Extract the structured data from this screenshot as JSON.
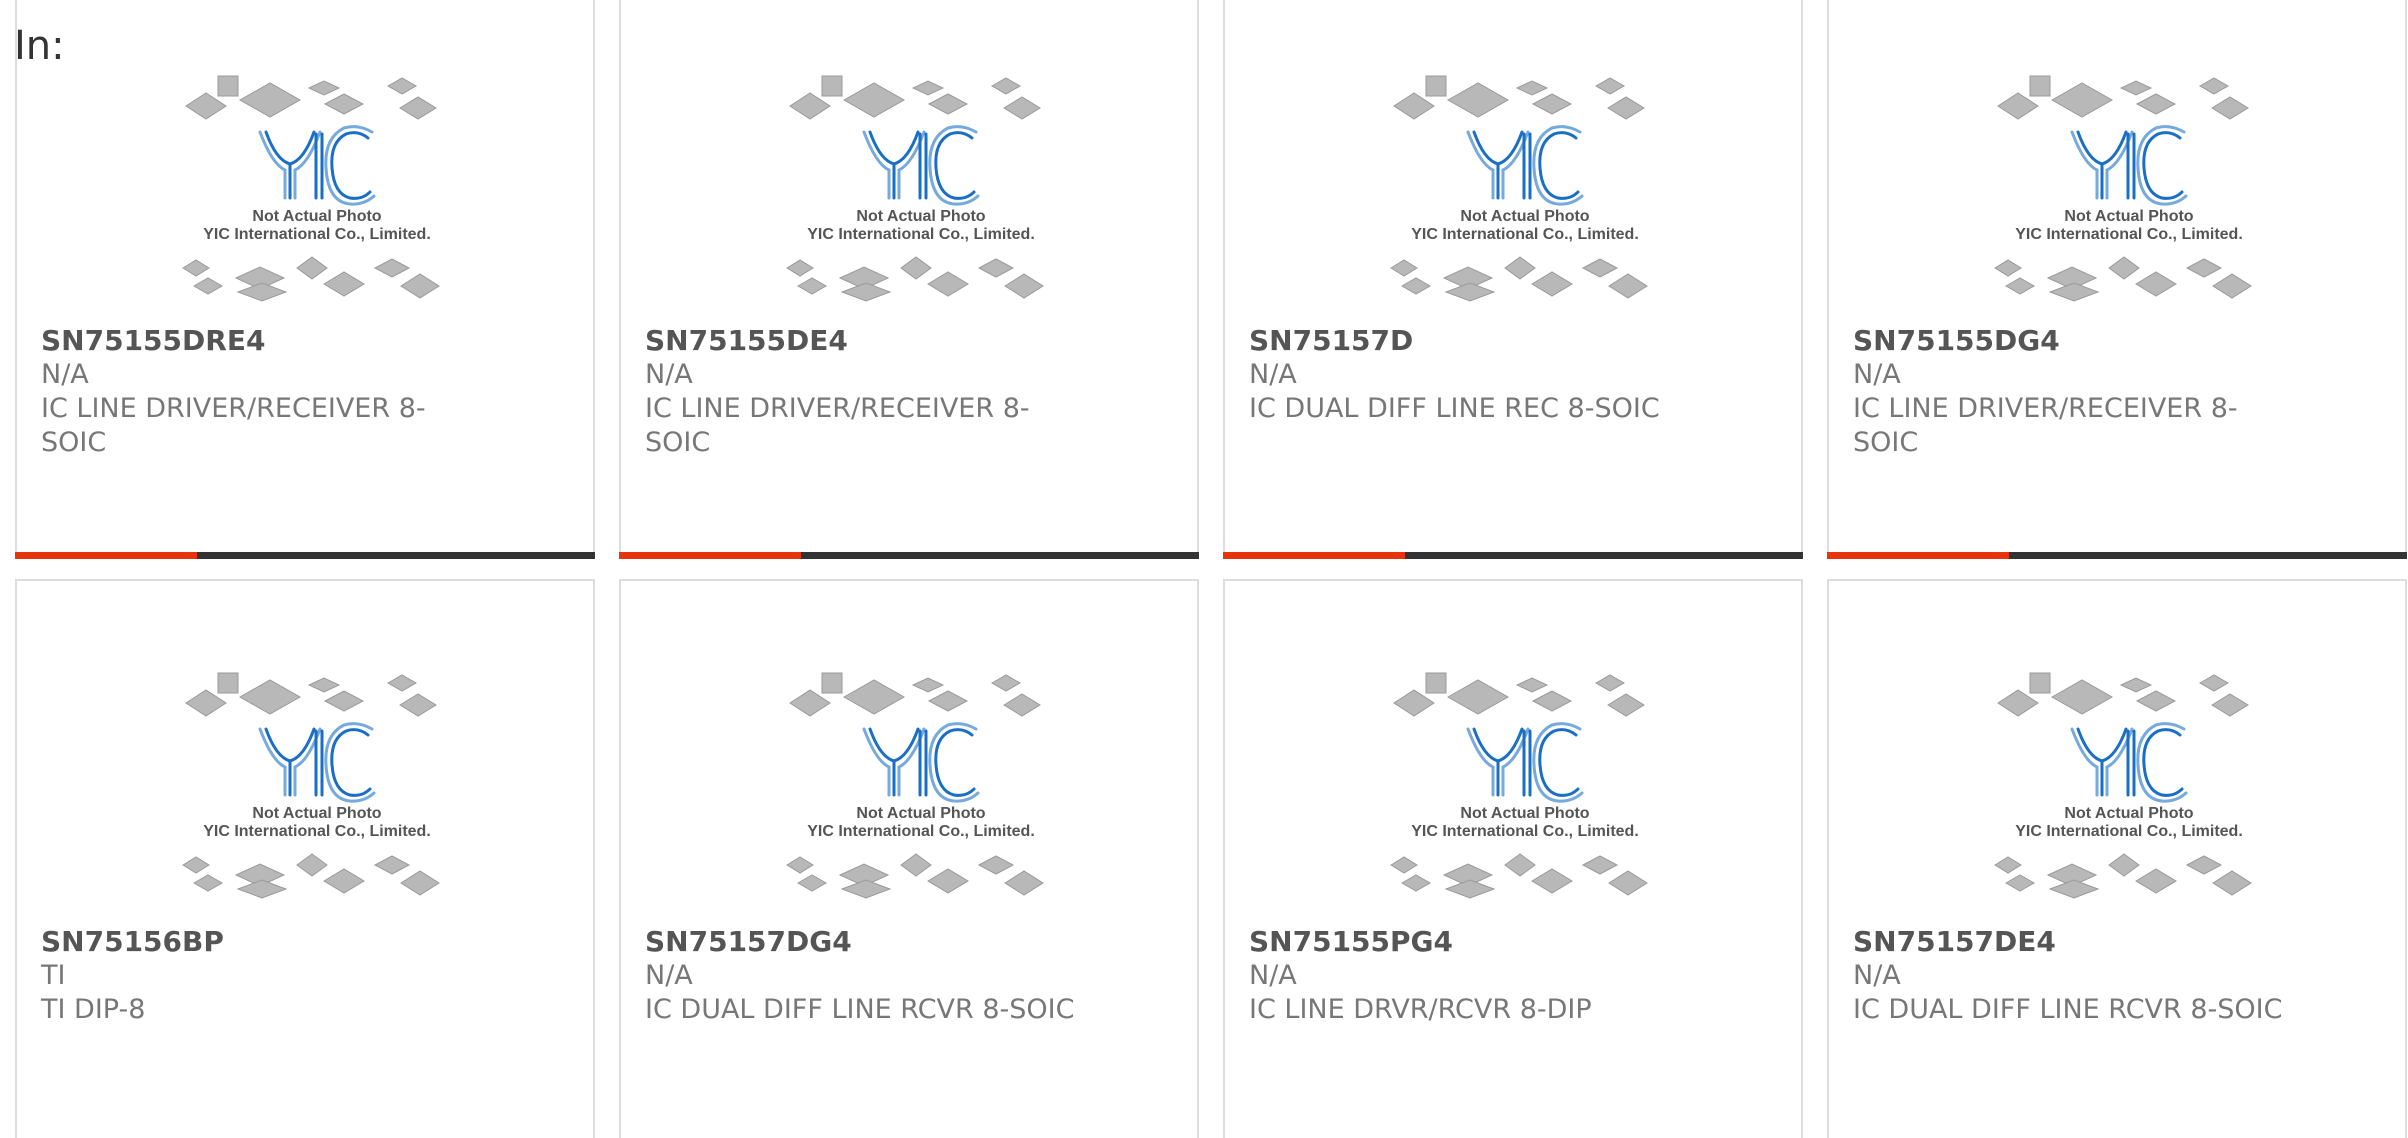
{
  "header": {
    "label": "In:"
  },
  "colors": {
    "accent": "#e8340c",
    "bar": "#333333",
    "logo_blue": "#1a6fc4",
    "chip_gray": "#b8b8b8"
  },
  "thumbnail": {
    "caption_line1": "Not Actual Photo",
    "caption_line2": "YIC International Co., Limited.",
    "logo_text": "YIC"
  },
  "products": [
    {
      "part_number": "SN75155DRE4",
      "manufacturer": "N/A",
      "description": "IC LINE DRIVER/RECEIVER 8-SOIC",
      "desc_line1": "IC LINE DRIVER/RECEIVER 8-",
      "desc_line2": "SOIC"
    },
    {
      "part_number": "SN75155DE4",
      "manufacturer": "N/A",
      "description": "IC LINE DRIVER/RECEIVER 8-SOIC",
      "desc_line1": "IC LINE DRIVER/RECEIVER 8-",
      "desc_line2": "SOIC"
    },
    {
      "part_number": "SN75157D",
      "manufacturer": "N/A",
      "description": "IC DUAL DIFF LINE REC 8-SOIC",
      "desc_line1": "IC DUAL DIFF LINE REC 8-SOIC",
      "desc_line2": ""
    },
    {
      "part_number": "SN75155DG4",
      "manufacturer": "N/A",
      "description": "IC LINE DRIVER/RECEIVER 8-SOIC",
      "desc_line1": "IC LINE DRIVER/RECEIVER 8-",
      "desc_line2": "SOIC"
    },
    {
      "part_number": "SN75156BP",
      "manufacturer": "TI",
      "description": "TI DIP-8",
      "desc_line1": "TI DIP-8",
      "desc_line2": ""
    },
    {
      "part_number": "SN75157DG4",
      "manufacturer": "N/A",
      "description": "IC DUAL DIFF LINE RCVR 8-SOIC",
      "desc_line1": "IC DUAL DIFF LINE RCVR 8-SOIC",
      "desc_line2": ""
    },
    {
      "part_number": "SN75155PG4",
      "manufacturer": "N/A",
      "description": "IC LINE DRVR/RCVR 8-DIP",
      "desc_line1": "IC LINE DRVR/RCVR 8-DIP",
      "desc_line2": ""
    },
    {
      "part_number": "SN75157DE4",
      "manufacturer": "N/A",
      "description": "IC DUAL DIFF LINE RCVR 8-SOIC",
      "desc_line1": "IC DUAL DIFF LINE RCVR 8-SOIC",
      "desc_line2": ""
    }
  ]
}
